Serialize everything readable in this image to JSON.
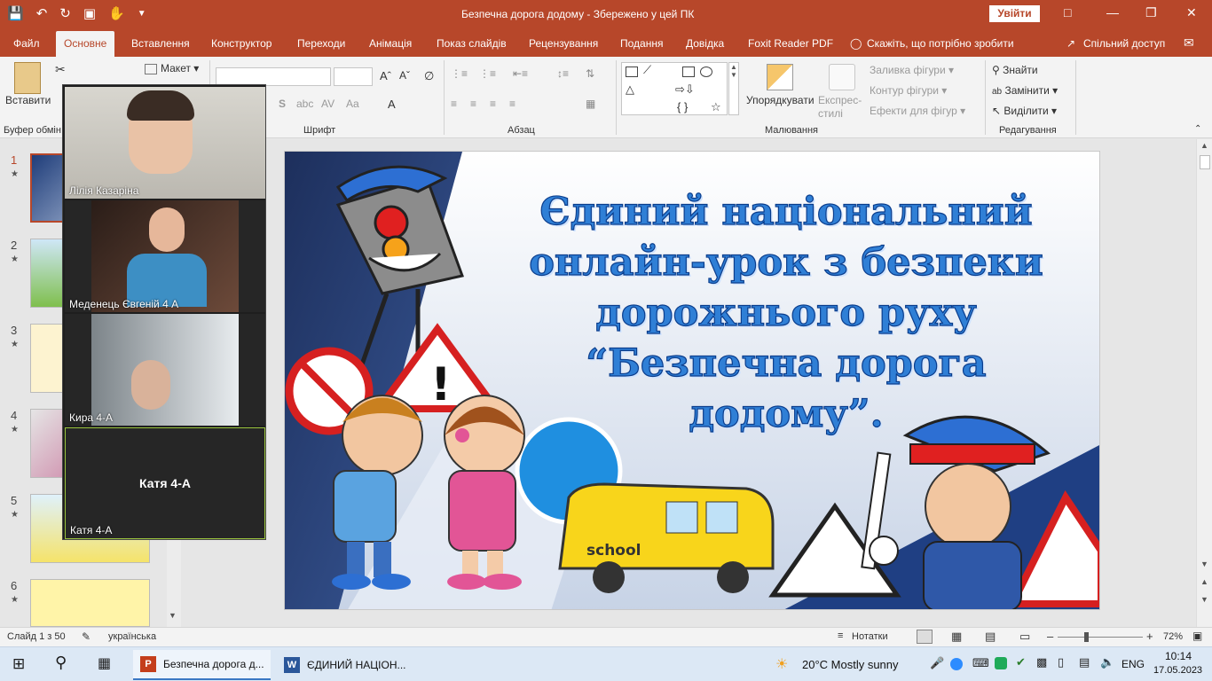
{
  "titlebar": {
    "doc_title": "Безпечна дорога додому  -  Збережено у цей ПК",
    "signin": "Увійти"
  },
  "tabs": [
    {
      "label": "Файл"
    },
    {
      "label": "Основне"
    },
    {
      "label": "Вставлення"
    },
    {
      "label": "Конструктор"
    },
    {
      "label": "Переходи"
    },
    {
      "label": "Анімація"
    },
    {
      "label": "Показ слайдів"
    },
    {
      "label": "Рецензування"
    },
    {
      "label": "Подання"
    },
    {
      "label": "Довідка"
    },
    {
      "label": "Foxit Reader PDF"
    },
    {
      "label": "Скажіть, що потрібно зробити"
    },
    {
      "label": "Спільний доступ"
    }
  ],
  "ribbon": {
    "paste": "Вставити",
    "clipboard": "Буфер обмін",
    "layout": "Макет",
    "font_group": "Шрифт",
    "paragraph_group": "Абзац",
    "drawing_group": "Малювання",
    "editing_group": "Редагування",
    "arrange": "Упорядкувати",
    "quick_styles": "Експрес-стилі",
    "shape_fill": "Заливка фігури",
    "shape_outline": "Контур фігури",
    "shape_effects": "Ефекти для фігур",
    "find": "Знайти",
    "replace": "Замінити",
    "select": "Виділити"
  },
  "thumbnails": [
    {
      "num": "1"
    },
    {
      "num": "2"
    },
    {
      "num": "3"
    },
    {
      "num": "4"
    },
    {
      "num": "5"
    },
    {
      "num": "6"
    }
  ],
  "slide": {
    "title_lines": [
      "Єдиний національний",
      "онлайн-урок з безпеки",
      "дорожнього руху",
      "“Безпечна дорога",
      "додому”."
    ],
    "sign_text": "school"
  },
  "zoom": {
    "participants": [
      {
        "name": "Лілія Казаріна"
      },
      {
        "name": "Меденець Євгеній 4 А"
      },
      {
        "name": "Кира 4-А"
      },
      {
        "name": "Катя  4-А",
        "center_label": "Катя  4-А"
      }
    ]
  },
  "status": {
    "slide_info": "Слайд 1 з 50",
    "language": "українська",
    "notes": "Нотатки",
    "zoom": "72%"
  },
  "taskbar": {
    "apps": [
      {
        "label": "Безпечна дорога д..."
      },
      {
        "label": "ЄДИНИЙ НАЦІОН..."
      }
    ],
    "weather": "20°C  Mostly sunny",
    "lang": "ENG",
    "time": "10:14",
    "date": "17.05.2023"
  }
}
